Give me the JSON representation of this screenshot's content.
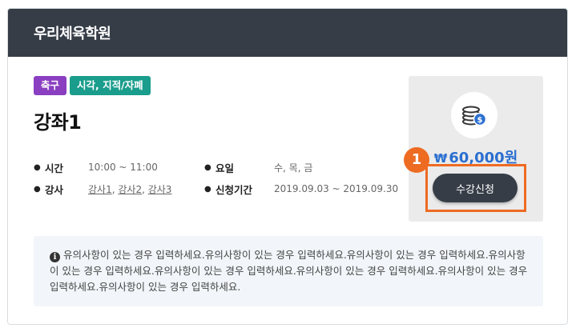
{
  "header": {
    "title": "우리체육학원"
  },
  "tags": [
    {
      "label": "축구",
      "color": "#8a3fc1"
    },
    {
      "label": "시각, 지적/자폐",
      "color": "#1a9d8c"
    }
  ],
  "course": {
    "title": "강좌1",
    "time_label": "시간",
    "time_value": "10:00 ~ 11:00",
    "teacher_label": "강사",
    "teachers": [
      "강사1",
      "강사2",
      "강사3"
    ],
    "day_label": "요일",
    "day_value": "수, 목, 금",
    "period_label": "신청기간",
    "period_value": "2019.09.03 ~ 2019.09.30"
  },
  "pricing": {
    "currency_symbol": "₩",
    "amount": "60,000원",
    "apply_label": "수강신청",
    "icon": "coins-icon"
  },
  "step_badge": "1",
  "notice": {
    "icon": "info-icon",
    "text": "유의사항이 있는 경우 입력하세요.유의사항이 있는 경우 입력하세요.유의사항이 있는 경우 입력하세요.유의사항이 있는 경우 입력하세요.유의사항이 있는 경우 입력하세요.유의사항이 있는 경우 입력하세요.유의사항이 있는 경우 입력하세요.유의사항이 있는 경우 입력하세요."
  },
  "colors": {
    "header_bg": "#363d47",
    "accent": "#ee6b22",
    "price": "#2b6fd0"
  }
}
